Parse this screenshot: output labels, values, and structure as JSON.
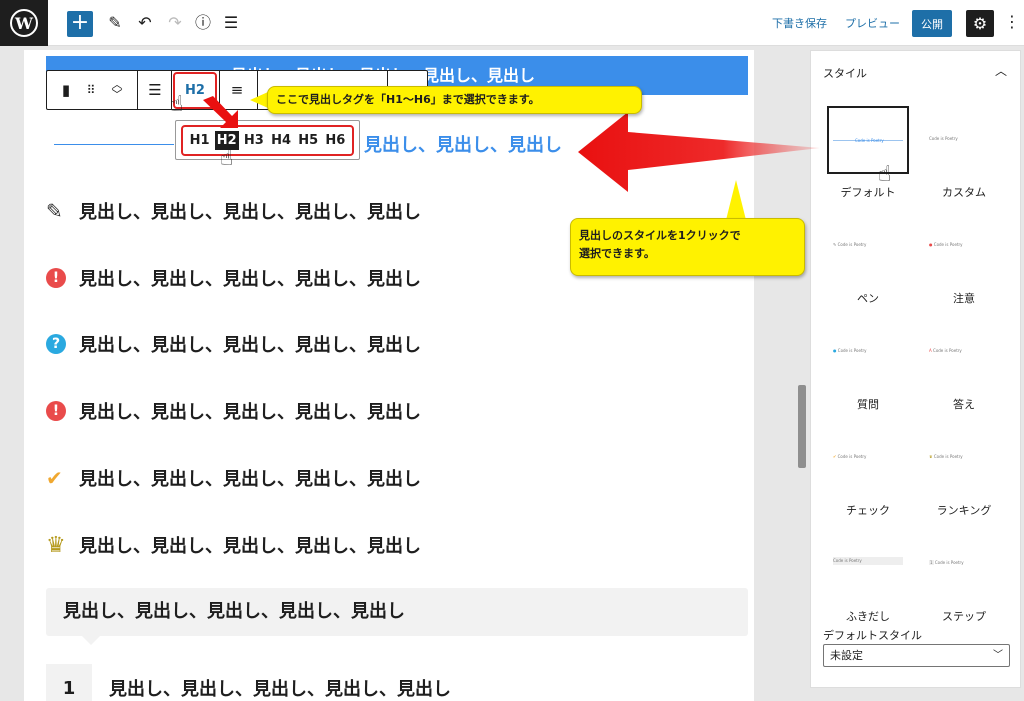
{
  "toolbar": {
    "add_label": "+",
    "save_draft": "下書き保存",
    "preview": "プレビュー",
    "publish": "公開"
  },
  "editor": {
    "selected_heading_text": "見出し、見出し、見出し、見出し、見出し",
    "h2_button_label": "H2",
    "heading_levels": [
      "H1",
      "H2",
      "H3",
      "H4",
      "H5",
      "H6"
    ],
    "active_level": "H2",
    "h2_visible_text": "見出し、見出し、見出し",
    "headings": [
      {
        "icon": "pen-icon",
        "text": "見出し、見出し、見出し、見出し、見出し"
      },
      {
        "icon": "alert-icon",
        "glyph": "!",
        "color": "#e94b4b",
        "text": "見出し、見出し、見出し、見出し、見出し"
      },
      {
        "icon": "question-icon",
        "glyph": "?",
        "color": "#2aa9e0",
        "text": "見出し、見出し、見出し、見出し、見出し"
      },
      {
        "icon": "alert-icon",
        "glyph": "!",
        "color": "#e94b4b",
        "text": "見出し、見出し、見出し、見出し、見出し"
      },
      {
        "icon": "check-icon",
        "glyph": "✔",
        "color": "#f0a830",
        "text": "見出し、見出し、見出し、見出し、見出し"
      },
      {
        "icon": "crown-icon",
        "glyph": "♛",
        "color": "#b59a1d",
        "text": "見出し、見出し、見出し、見出し、見出し"
      }
    ],
    "bubble_heading": "見出し、見出し、見出し、見出し、見出し",
    "step_number": "1",
    "step_heading": "見出し、見出し、見出し、見出し、見出し"
  },
  "callouts": {
    "tag_select": "ここで見出しタグを「H1～H6」まで選択できます。",
    "style_select_line1": "見出しのスタイルを1クリックで",
    "style_select_line2": "選択できます。"
  },
  "sidebar": {
    "title": "スタイル",
    "thumb_text": "Code is Poetry",
    "styles": [
      {
        "label": "デフォルト"
      },
      {
        "label": "カスタム"
      },
      {
        "label": "ペン"
      },
      {
        "label": "注意"
      },
      {
        "label": "質問"
      },
      {
        "label": "答え"
      },
      {
        "label": "チェック"
      },
      {
        "label": "ランキング"
      },
      {
        "label": "ふきだし"
      },
      {
        "label": "ステップ"
      }
    ],
    "default_style_label": "デフォルトスタイル",
    "default_style_value": "未設定"
  }
}
